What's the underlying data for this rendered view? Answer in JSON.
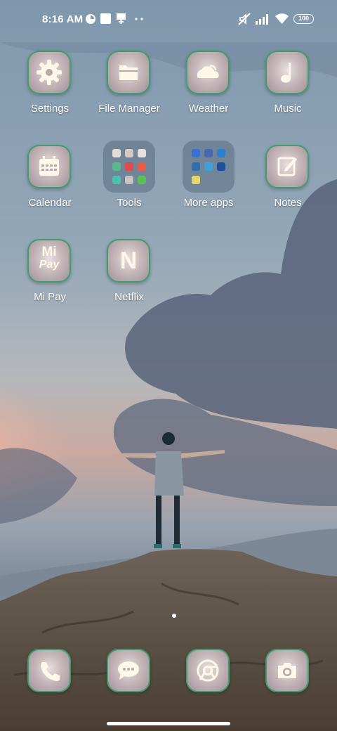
{
  "status_bar": {
    "time": "8:16 AM",
    "battery": "100",
    "icons": [
      "data-saver-icon",
      "notification-square-icon",
      "download-icon",
      "more-dots-icon",
      "mute-icon",
      "signal-icon",
      "wifi-icon",
      "battery-icon"
    ]
  },
  "apps": [
    {
      "label": "Settings",
      "icon": "gear-icon"
    },
    {
      "label": "File Manager",
      "icon": "folder-icon"
    },
    {
      "label": "Weather",
      "icon": "weather-icon"
    },
    {
      "label": "Music",
      "icon": "music-note-icon"
    },
    {
      "label": "Calendar",
      "icon": "calendar-icon"
    },
    {
      "label": "Tools",
      "icon": "folder-tools"
    },
    {
      "label": "More apps",
      "icon": "folder-more-apps"
    },
    {
      "label": "Notes",
      "icon": "notes-icon"
    },
    {
      "label": "Mi Pay",
      "icon": "mi-pay-icon"
    },
    {
      "label": "Netflix",
      "icon": "netflix-icon"
    }
  ],
  "icon_text": {
    "mipay_top": "Mi",
    "mipay_bottom": "Pay",
    "netflix": "N"
  },
  "dock": [
    {
      "icon": "phone-icon"
    },
    {
      "icon": "messages-icon"
    },
    {
      "icon": "chrome-icon"
    },
    {
      "icon": "camera-icon"
    }
  ],
  "page_indicator": {
    "pages": 1,
    "active": 1
  },
  "colors": {
    "icon_border": "#3f9e6c",
    "icon_glyph": "#fff8e8",
    "folder_bg": "#5a6e82"
  }
}
